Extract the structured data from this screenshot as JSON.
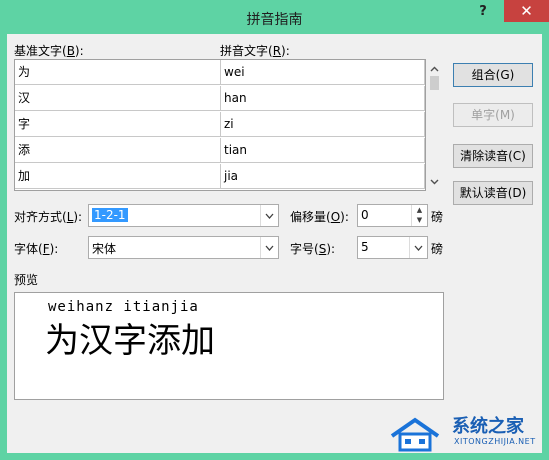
{
  "window": {
    "title": "拼音指南",
    "help": "?",
    "close": "✕"
  },
  "labels": {
    "base_text": "基准文字(",
    "base_key": "B",
    "base_end": "):",
    "ruby_text": "拼音文字(",
    "ruby_key": "R",
    "ruby_end": "):"
  },
  "rows": [
    {
      "base": "为",
      "ruby": "wei"
    },
    {
      "base": "汉",
      "ruby": "han"
    },
    {
      "base": "字",
      "ruby": "zi"
    },
    {
      "base": "添",
      "ruby": "tian"
    },
    {
      "base": "加",
      "ruby": "jia"
    }
  ],
  "buttons": {
    "group": "组合(G)",
    "mono": "单字(M)",
    "clear": "清除读音(C)",
    "default": "默认读音(D)"
  },
  "alignment": {
    "label": "对齐方式(",
    "key": "L",
    "end": "):",
    "value": "1-2-1"
  },
  "offset": {
    "label": "偏移量(",
    "key": "O",
    "end": "):",
    "value": "0",
    "unit": "磅"
  },
  "font": {
    "label": "字体(",
    "key": "F",
    "end": "):",
    "value": "宋体"
  },
  "size": {
    "label": "字号(",
    "key": "S",
    "end": "):",
    "value": "5",
    "unit": "磅"
  },
  "preview": {
    "label": "预览",
    "ruby_line": "weihanz itianjia",
    "base_line": "为汉字添加"
  },
  "watermark": {
    "brand": "系统之家",
    "url": "XITONGZHIJIA.NET"
  },
  "colors": {
    "titlebar": "#5ed3a4",
    "close": "#c7423f",
    "selection": "#3399ff"
  }
}
